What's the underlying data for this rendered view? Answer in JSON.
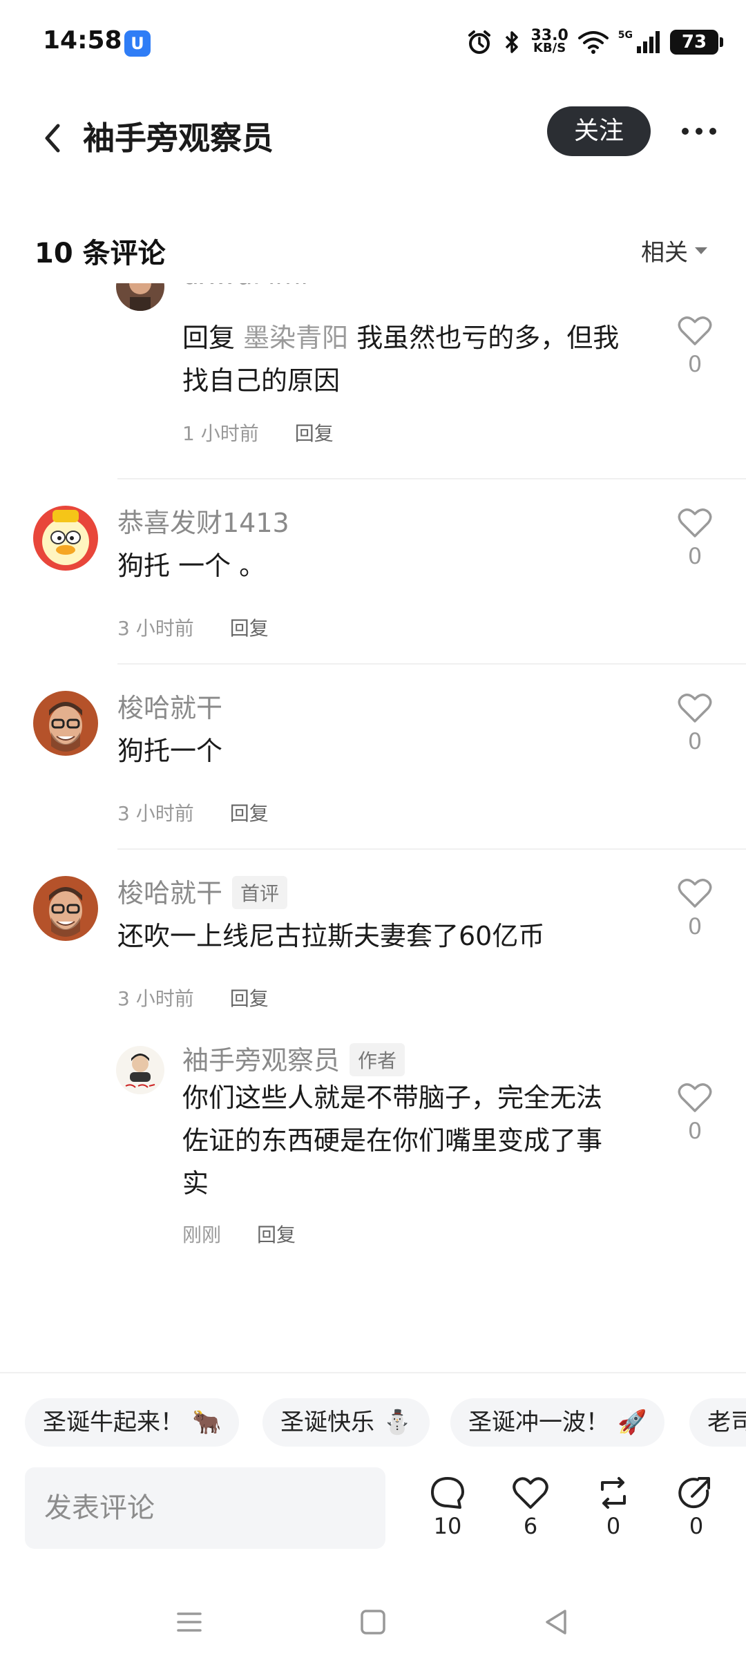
{
  "status_bar": {
    "time": "14:58",
    "app_icon_glyph": "U",
    "net_speed_value": "33.0",
    "net_speed_unit": "KB/S",
    "network_type": "5G",
    "battery": "73"
  },
  "header": {
    "title": "袖手旁观察员",
    "follow_label": "关注"
  },
  "comments_header": {
    "count_label": "10 条评论",
    "sort_label": "相关"
  },
  "comments": [
    {
      "name": "uxwdPimi",
      "mention_prefix": "回复 ",
      "mention": "墨染青阳",
      "text_line1": " 我虽然也亏的多，但我",
      "text_line2": "找自己的原因",
      "time": "1 小时前",
      "reply_label": "回复",
      "likes": "0"
    },
    {
      "name": "恭喜发财1413",
      "text": "狗托 一个 。",
      "time": "3 小时前",
      "reply_label": "回复",
      "likes": "0"
    },
    {
      "name": "梭哈就干",
      "text": "狗托一个",
      "time": "3 小时前",
      "reply_label": "回复",
      "likes": "0"
    },
    {
      "name": "梭哈就干",
      "badge": "首评",
      "text": "还吹一上线尼古拉斯夫妻套了60亿币",
      "time": "3 小时前",
      "reply_label": "回复",
      "likes": "0"
    },
    {
      "name": "袖手旁观察员",
      "badge": "作者",
      "text_line1": "你们这些人就是不带脑子，完全无法",
      "text_line2": "佐证的东西硬是在你们嘴里变成了事",
      "text_line3": "实",
      "time": "刚刚",
      "reply_label": "回复",
      "likes": "0"
    }
  ],
  "quick_reactions": [
    {
      "label": "圣诞牛起来！",
      "emoji": "🐂"
    },
    {
      "label": "圣诞快乐",
      "emoji": "⛄"
    },
    {
      "label": "圣诞冲一波！",
      "emoji": "🚀"
    },
    {
      "label": "老司",
      "emoji": ""
    }
  ],
  "bottom_bar": {
    "input_placeholder": "发表评论",
    "comments_count": "10",
    "likes_count": "6",
    "reposts_count": "0",
    "shares_count": "0"
  },
  "colors": {
    "follow_button_bg": "#2b2e33",
    "mention_color": "#9a9a9a",
    "status_app_icon": "#2f7df6"
  }
}
